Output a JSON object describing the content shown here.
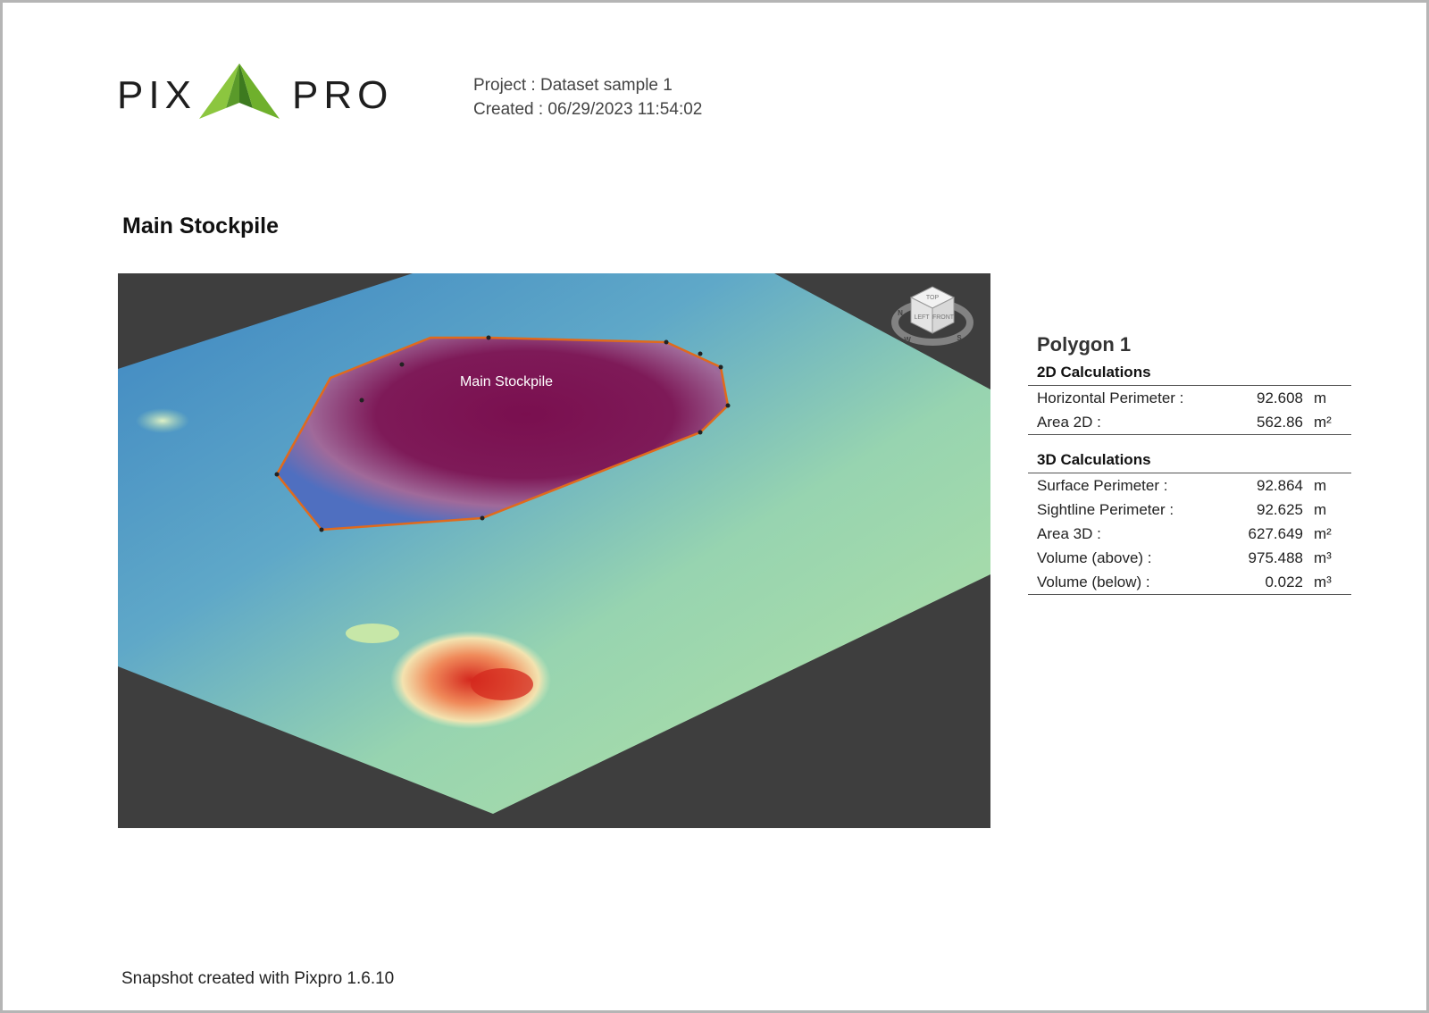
{
  "logo": {
    "left_text": "PIX",
    "right_text": "PRO"
  },
  "meta": {
    "project_line": "Project : Dataset sample 1",
    "created_line": "Created : 06/29/2023 11:54:02"
  },
  "section_title": "Main Stockpile",
  "view": {
    "polygon_label": "Main Stockpile",
    "nav_cube": {
      "top": "TOP",
      "left": "LEFT",
      "front": "FRONT",
      "compass_n": "N",
      "compass_w": "W",
      "compass_s": "S"
    }
  },
  "panel": {
    "title": "Polygon 1",
    "calc2d": {
      "heading": "2D Calculations",
      "rows": [
        {
          "label": "Horizontal Perimeter :",
          "value": "92.608",
          "unit": "m"
        },
        {
          "label": "Area 2D :",
          "value": "562.86",
          "unit": "m²"
        }
      ]
    },
    "calc3d": {
      "heading": "3D Calculations",
      "rows": [
        {
          "label": "Surface Perimeter :",
          "value": "92.864",
          "unit": "m"
        },
        {
          "label": "Sightline Perimeter :",
          "value": "92.625",
          "unit": "m"
        },
        {
          "label": "Area 3D :",
          "value": "627.649",
          "unit": "m²"
        },
        {
          "label": "Volume (above) :",
          "value": "975.488",
          "unit": "m³"
        },
        {
          "label": "Volume (below) :",
          "value": "0.022",
          "unit": "m³"
        }
      ]
    }
  },
  "footer": "Snapshot created with Pixpro 1.6.10",
  "colors": {
    "stockpile": "#7a0f4f",
    "terrain_low": "#3e86c2",
    "terrain_mid": "#a9dfa6",
    "hotspot": "#d4281e",
    "polygon_outline": "#e06a1c",
    "view_background": "#3e3e3e",
    "logo_green": "#7ab828"
  }
}
